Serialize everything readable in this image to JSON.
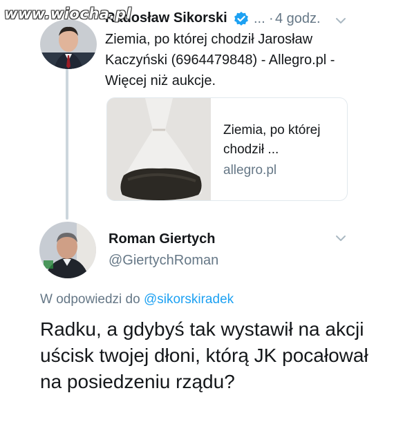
{
  "watermark": "www.wiocha.pl",
  "tweet1": {
    "author_name": "Radosław Sikorski",
    "more": "...",
    "separator": "·",
    "time": "4 godz.",
    "text": "Ziemia, po której chodził Jarosław Kaczyński (6964479848) - Allegro.pl - Więcej niż aukcje.",
    "card": {
      "title": "Ziemia, po której chodził ...",
      "domain": "allegro.pl"
    }
  },
  "tweet2": {
    "author_name": "Roman Giertych",
    "handle": "@GiertychRoman",
    "reply_prefix": "W odpowiedzi do",
    "reply_handle": "@sikorskiradek",
    "text": "Radku, a gdybyś tak wystawił na akcji uścisk twojej dłoni, którą JK pocałował na posiedzeniu rządu?"
  },
  "colors": {
    "text": "#14171a",
    "muted": "#657786",
    "link": "#1da1f2",
    "verified": "#1da1f2",
    "thread_line": "#ccd6dd",
    "border": "#e1e8ed"
  },
  "icons": {
    "verified": "verified-badge-icon",
    "chevron": "chevron-down-icon"
  }
}
